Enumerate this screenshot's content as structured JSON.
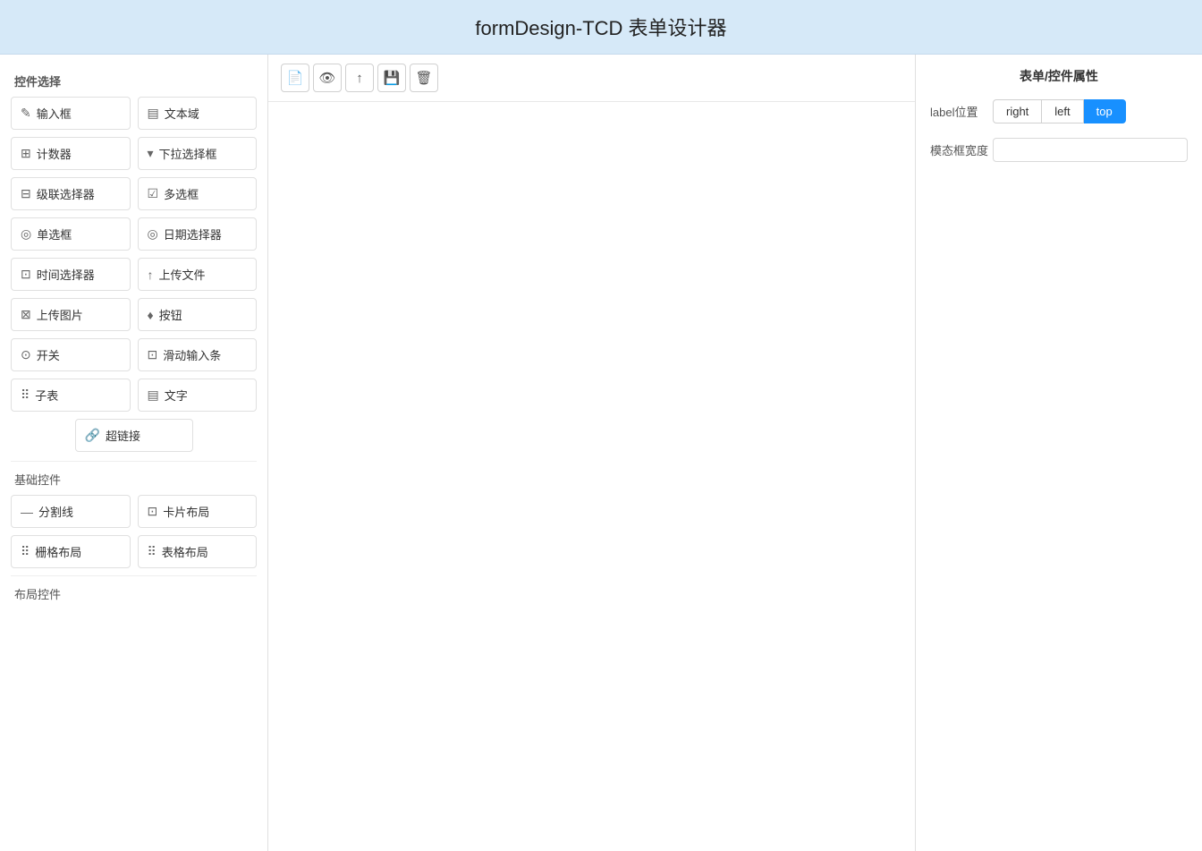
{
  "header": {
    "title": "formDesign-TCD 表单设计器"
  },
  "left_panel": {
    "title": "控件选择",
    "controls": [
      {
        "id": "input",
        "icon": "✎",
        "label": "输入框"
      },
      {
        "id": "textarea",
        "icon": "▤",
        "label": "文本域"
      },
      {
        "id": "counter",
        "icon": "⊞",
        "label": "计数器"
      },
      {
        "id": "dropdown",
        "icon": "▾",
        "label": "下拉选择框"
      },
      {
        "id": "cascader",
        "icon": "⊟",
        "label": "级联选择器"
      },
      {
        "id": "checkbox",
        "icon": "☑",
        "label": "多选框"
      },
      {
        "id": "radio",
        "icon": "◎",
        "label": "单选框"
      },
      {
        "id": "datepicker",
        "icon": "◎",
        "label": "日期选择器"
      },
      {
        "id": "timepicker",
        "icon": "⊡",
        "label": "时间选择器"
      },
      {
        "id": "upload-file",
        "icon": "↑",
        "label": "上传文件"
      },
      {
        "id": "upload-image",
        "icon": "⊠",
        "label": "上传图片"
      },
      {
        "id": "button",
        "icon": "♦",
        "label": "按钮"
      },
      {
        "id": "switch",
        "icon": "⊙",
        "label": "开关"
      },
      {
        "id": "slider",
        "icon": "⊡",
        "label": "滑动输入条"
      },
      {
        "id": "subtable",
        "icon": "⠿",
        "label": "子表"
      },
      {
        "id": "text",
        "icon": "▤",
        "label": "文字"
      }
    ],
    "hyperlink": {
      "icon": "🔗",
      "label": "超链接"
    },
    "basic_label": "基础控件",
    "basic_controls": [
      {
        "id": "divider",
        "icon": "—",
        "label": "分割线"
      },
      {
        "id": "card-layout",
        "icon": "⊡",
        "label": "卡片布局"
      },
      {
        "id": "grid-layout",
        "icon": "⠿",
        "label": "栅格布局"
      },
      {
        "id": "table-layout",
        "icon": "⠿",
        "label": "表格布局"
      }
    ],
    "layout_label": "布局控件"
  },
  "toolbar": {
    "buttons": [
      {
        "id": "new",
        "icon": "📄"
      },
      {
        "id": "preview",
        "icon": "👁"
      },
      {
        "id": "import",
        "icon": "↑"
      },
      {
        "id": "save",
        "icon": "💾"
      },
      {
        "id": "delete",
        "icon": "🗑"
      }
    ]
  },
  "right_panel": {
    "title": "表单/控件属性",
    "label_position_label": "label位置",
    "label_position_options": [
      {
        "value": "right",
        "label": "right",
        "active": false
      },
      {
        "value": "left",
        "label": "left",
        "active": false
      },
      {
        "value": "top",
        "label": "top",
        "active": true
      }
    ],
    "modal_width_label": "模态框宽度",
    "modal_width_value": ""
  }
}
